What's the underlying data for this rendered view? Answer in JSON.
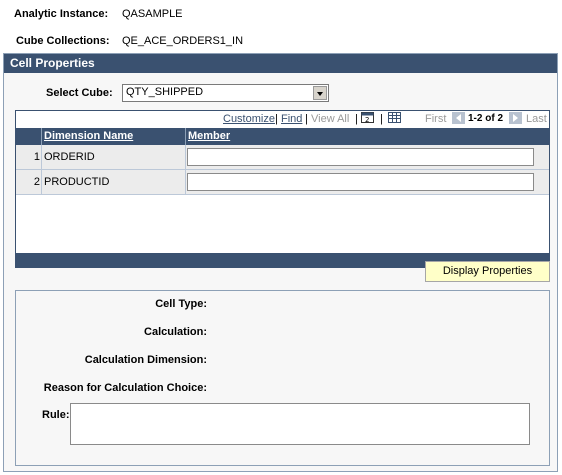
{
  "header": {
    "analytic_instance_label": "Analytic Instance:",
    "analytic_instance_value": "QASAMPLE",
    "cube_collections_label": "Cube Collections:",
    "cube_collections_value": "QE_ACE_ORDERS1_IN"
  },
  "group": {
    "title": "Cell Properties",
    "select_cube_label": "Select Cube:",
    "select_cube_value": "QTY_SHIPPED"
  },
  "grid": {
    "nav": {
      "customize": "Customize",
      "sep1": "|",
      "find": "Find",
      "sep2": "|",
      "view_all": "View All",
      "sep3": "|",
      "sep4": "|",
      "first": "First",
      "range": "1-2 of 2",
      "last": "Last"
    },
    "columns": [
      "Dimension Name",
      "Member"
    ],
    "rows": [
      {
        "num": "1",
        "dimension": "ORDERID",
        "member": ""
      },
      {
        "num": "2",
        "dimension": "PRODUCTID",
        "member": ""
      }
    ]
  },
  "buttons": {
    "display_properties": "Display Properties"
  },
  "properties": {
    "cell_type_label": "Cell Type:",
    "calculation_label": "Calculation:",
    "calculation_dimension_label": "Calculation Dimension:",
    "reason_label": "Reason for Calculation Choice:",
    "rule_label": "Rule:",
    "rule_value": ""
  },
  "colors": {
    "header_bar": "#3a5170",
    "button_bg": "#ffffc8",
    "panel_bg": "#f7f7f7"
  }
}
